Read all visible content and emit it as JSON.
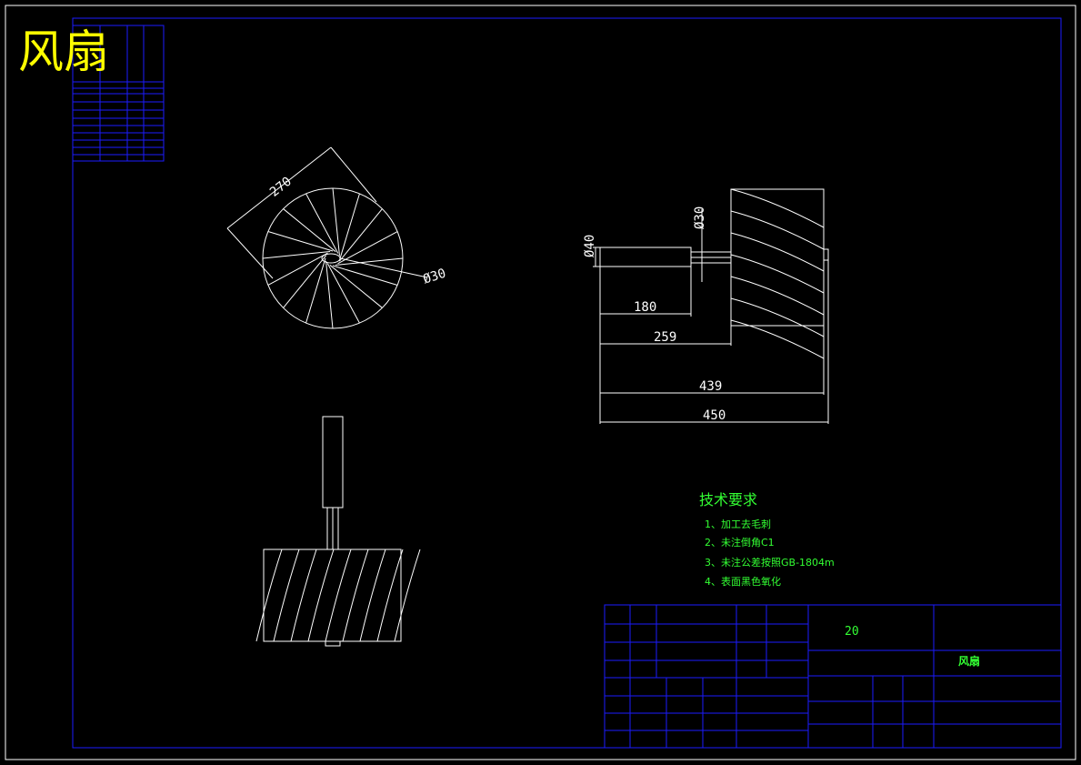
{
  "drawing": {
    "big_title": "风扇",
    "colors": {
      "background": "#000000",
      "frame": "#1b1bff",
      "geometry": "#ffffff",
      "tech_text": "#33ff33",
      "title": "#ffff00"
    }
  },
  "dimensions": {
    "front_diameter": "270",
    "front_hub": "Ø30",
    "shaft_dia": "Ø40",
    "neck_dia": "Ø30",
    "len_180": "180",
    "len_259": "259",
    "len_439": "439",
    "len_450": "450"
  },
  "tech_requirements": {
    "heading": "技术要求",
    "items": [
      "1、加工去毛刺",
      "2、未注倒角C1",
      "3、未注公差按照GB-1804m",
      "4、表面黑色氧化"
    ]
  },
  "title_block": {
    "quantity": "20",
    "part_name": "风扇"
  }
}
